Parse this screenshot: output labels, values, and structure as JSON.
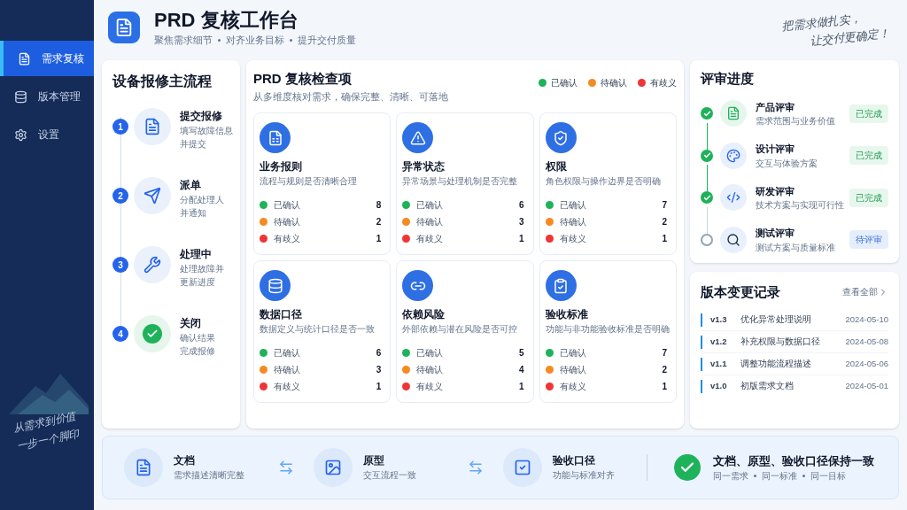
{
  "sidebar": {
    "items": [
      {
        "label": "需求复核",
        "selected": true
      },
      {
        "label": "版本管理",
        "selected": false
      },
      {
        "label": "设置",
        "selected": false
      }
    ],
    "slogan": [
      "从需求到价值",
      "一步一个脚印"
    ]
  },
  "header": {
    "title": "PRD 复核工作台",
    "subtitle": [
      "聚焦需求细节",
      "对齐业务目标",
      "提升交付质量"
    ],
    "slogan": [
      "把需求做扎实，",
      "让交付更确定！"
    ]
  },
  "flow": {
    "title": "设备报修主流程",
    "steps": [
      {
        "number": "1",
        "title": "提交报修",
        "description": [
          "填写故障信息",
          "并提交"
        ],
        "done": false
      },
      {
        "number": "2",
        "title": "派单",
        "description": [
          "分配处理人",
          "并通知"
        ],
        "done": false
      },
      {
        "number": "3",
        "title": "处理中",
        "description": [
          "处理故障并",
          "更新进度"
        ],
        "done": false
      },
      {
        "number": "4",
        "title": "关闭",
        "description": [
          "确认结果",
          "完成报修"
        ],
        "done": true
      }
    ]
  },
  "checks": {
    "title": "PRD 复核检查项",
    "subtitle": "从多维度核对需求，确保完整、清晰、可落地",
    "legend": [
      {
        "label": "已确认",
        "color": "#1eb25a"
      },
      {
        "label": "待确认",
        "color": "#f58a23"
      },
      {
        "label": "有歧义",
        "color": "#ee3535"
      }
    ],
    "cards": [
      {
        "title": "业务报则",
        "description": "流程与规则是否清晰合理",
        "counts": [
          {
            "label": "已确认",
            "value": "8",
            "color": "#1eb25a"
          },
          {
            "label": "待确认",
            "value": "2",
            "color": "#f58a23"
          },
          {
            "label": "有歧义",
            "value": "1",
            "color": "#ee3535"
          }
        ]
      },
      {
        "title": "异常状态",
        "description": "异常场景与处理机制是否完整",
        "counts": [
          {
            "label": "已确认",
            "value": "6",
            "color": "#1eb25a"
          },
          {
            "label": "待确认",
            "value": "3",
            "color": "#f58a23"
          },
          {
            "label": "有歧义",
            "value": "1",
            "color": "#ee3535"
          }
        ]
      },
      {
        "title": "权限",
        "description": "角色权限与操作边界是否明确",
        "counts": [
          {
            "label": "已确认",
            "value": "7",
            "color": "#1eb25a"
          },
          {
            "label": "待确认",
            "value": "2",
            "color": "#f58a23"
          },
          {
            "label": "有歧义",
            "value": "1",
            "color": "#ee3535"
          }
        ]
      },
      {
        "title": "数据口径",
        "description": "数据定义与统计口径是否一致",
        "counts": [
          {
            "label": "已确认",
            "value": "6",
            "color": "#1eb25a"
          },
          {
            "label": "待确认",
            "value": "3",
            "color": "#f58a23"
          },
          {
            "label": "有歧义",
            "value": "1",
            "color": "#ee3535"
          }
        ]
      },
      {
        "title": "依赖风险",
        "description": "外部依赖与潜在风险是否可控",
        "counts": [
          {
            "label": "已确认",
            "value": "5",
            "color": "#1eb25a"
          },
          {
            "label": "待确认",
            "value": "4",
            "color": "#f58a23"
          },
          {
            "label": "有歧义",
            "value": "1",
            "color": "#ee3535"
          }
        ]
      },
      {
        "title": "验收标准",
        "description": "功能与非功能验收标准是否明确",
        "counts": [
          {
            "label": "已确认",
            "value": "7",
            "color": "#1eb25a"
          },
          {
            "label": "待确认",
            "value": "2",
            "color": "#f58a23"
          },
          {
            "label": "有歧义",
            "value": "1",
            "color": "#ee3535"
          }
        ]
      }
    ]
  },
  "review": {
    "title": "评审进度",
    "stages": [
      {
        "title": "产品评审",
        "description": "需求范围与业务价值",
        "status": "已完成",
        "done": true
      },
      {
        "title": "设计评审",
        "description": "交互与体验方案",
        "status": "已完成",
        "done": true
      },
      {
        "title": "研发评审",
        "description": "技术方案与实现可行性",
        "status": "已完成",
        "done": true
      },
      {
        "title": "测试评审",
        "description": "测试方案与质量标准",
        "status": "待评审",
        "done": false
      }
    ]
  },
  "changelog": {
    "title": "版本变更记录",
    "link": "查看全部",
    "entries": [
      {
        "version": "v1.3",
        "description": "优化异常处理说明",
        "date": "2024-05-10"
      },
      {
        "version": "v1.2",
        "description": "补充权限与数据口径",
        "date": "2024-05-08"
      },
      {
        "version": "v1.1",
        "description": "调整功能流程描述",
        "date": "2024-05-06"
      },
      {
        "version": "v1.0",
        "description": "初版需求文档",
        "date": "2024-05-01"
      }
    ]
  },
  "alignment": {
    "items": [
      {
        "title": "文档",
        "description": "需求描述清晰完整"
      },
      {
        "title": "原型",
        "description": "交互流程一致"
      },
      {
        "title": "验收口径",
        "description": "功能与标准对齐"
      }
    ],
    "summary": {
      "title": "文档、原型、验收口径保持一致",
      "points": [
        "同一需求",
        "同一标准",
        "同一目标"
      ]
    }
  }
}
